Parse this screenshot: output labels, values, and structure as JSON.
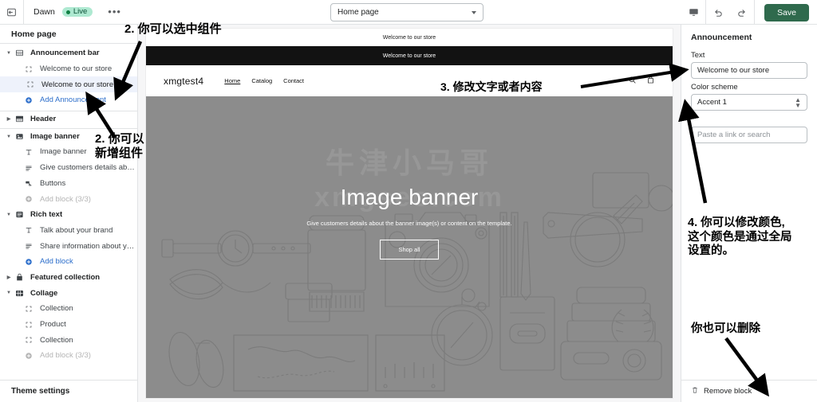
{
  "topbar": {
    "exit_icon": "exit-editor-icon",
    "theme_name": "Dawn",
    "live_badge": "Live",
    "more_label": "•••",
    "page_selector_value": "Home page",
    "preview_device_icon": "desktop-icon",
    "undo_icon": "undo-icon",
    "redo_icon": "redo-icon",
    "save_label": "Save"
  },
  "sidebar": {
    "title": "Home page",
    "footer_label": "Theme settings",
    "items": [
      {
        "label": "Announcement bar",
        "type": "section",
        "icon": "announcement-bar-icon",
        "expanded": true
      },
      {
        "label": "Welcome to our store",
        "type": "block",
        "icon": "block-icon"
      },
      {
        "label": "Welcome to our store",
        "type": "block",
        "icon": "block-icon",
        "selected": true
      },
      {
        "label": "Add Announcement",
        "type": "add",
        "icon": "plus-circle-icon"
      },
      {
        "label": "Header",
        "type": "section",
        "icon": "header-icon",
        "expanded": false,
        "divider": true
      },
      {
        "label": "Image banner",
        "type": "section",
        "icon": "image-banner-icon",
        "expanded": true,
        "divider": true
      },
      {
        "label": "Image banner",
        "type": "block",
        "icon": "text-icon"
      },
      {
        "label": "Give customers details about t...",
        "type": "block",
        "icon": "paragraph-icon"
      },
      {
        "label": "Buttons",
        "type": "block",
        "icon": "buttons-icon"
      },
      {
        "label": "Add block (3/3)",
        "type": "add",
        "icon": "plus-circle-icon",
        "disabled": true
      },
      {
        "label": "Rich text",
        "type": "section",
        "icon": "rich-text-icon",
        "expanded": true
      },
      {
        "label": "Talk about your brand",
        "type": "block",
        "icon": "text-icon"
      },
      {
        "label": "Share information about your b...",
        "type": "block",
        "icon": "paragraph-icon"
      },
      {
        "label": "Add block",
        "type": "add",
        "icon": "plus-circle-icon"
      },
      {
        "label": "Featured collection",
        "type": "section",
        "icon": "collection-icon",
        "expanded": false
      },
      {
        "label": "Collage",
        "type": "section",
        "icon": "collage-icon",
        "expanded": true
      },
      {
        "label": "Collection",
        "type": "block",
        "icon": "block-icon"
      },
      {
        "label": "Product",
        "type": "block",
        "icon": "block-icon"
      },
      {
        "label": "Collection",
        "type": "block",
        "icon": "block-icon"
      },
      {
        "label": "Add block (3/3)",
        "type": "add",
        "icon": "plus-circle-icon",
        "disabled": true
      }
    ]
  },
  "preview": {
    "announcement_1": "Welcome to our store",
    "announcement_2": "Welcome to our store",
    "brand": "xmgtest4",
    "nav": [
      {
        "label": "Home",
        "active": true
      },
      {
        "label": "Catalog",
        "active": false
      },
      {
        "label": "Contact",
        "active": false
      }
    ],
    "search_icon": "search-icon",
    "cart_icon": "cart-icon",
    "banner_title": "Image banner",
    "banner_subtitle": "Give customers details about the banner image(s) or content on the template.",
    "banner_button": "Shop all",
    "watermark_line1": "牛津小马哥",
    "watermark_line2": "xmgseo.com",
    "banner_bg_color": "#8c8c8c",
    "announcement_2_bg": "#121212"
  },
  "right_panel": {
    "title": "Announcement",
    "text_label": "Text",
    "text_value": "Welcome to our store",
    "color_scheme_label": "Color scheme",
    "color_scheme_value": "Accent 1",
    "link_placeholder": "Paste a link or search",
    "link_value": "",
    "remove_label": "Remove block",
    "remove_icon": "trash-icon"
  },
  "annotations": {
    "a1": "2. 你可以选中组件",
    "a2": "2. 你可以\n新增组件",
    "a3": "3. 修改文字或者内容",
    "a4": "4. 你可以修改颜色,\n这个颜色是通过全局\n设置的。",
    "a5": "你也可以删除"
  }
}
